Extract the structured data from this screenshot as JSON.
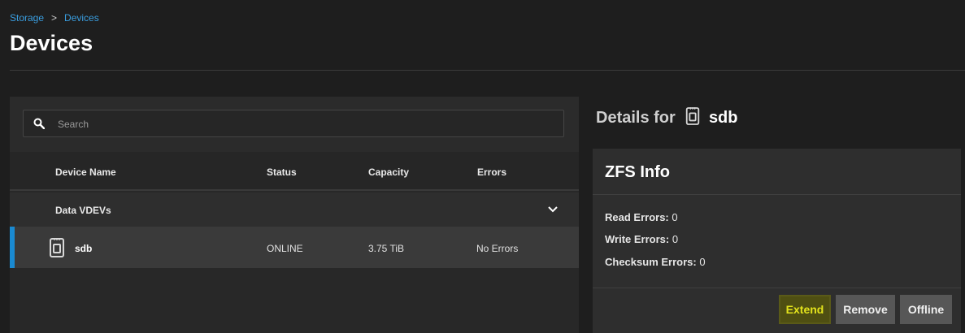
{
  "breadcrumb": {
    "items": [
      "Storage",
      "Devices"
    ],
    "separator": ">"
  },
  "page": {
    "title": "Devices"
  },
  "search": {
    "placeholder": "Search",
    "value": ""
  },
  "table": {
    "columns": [
      "Device Name",
      "Status",
      "Capacity",
      "Errors"
    ],
    "group": {
      "label": "Data VDEVs"
    },
    "rows": [
      {
        "name": "sdb",
        "status": "ONLINE",
        "capacity": "3.75 TiB",
        "errors": "No Errors"
      }
    ]
  },
  "details": {
    "heading_prefix": "Details for",
    "device": "sdb",
    "card_title": "ZFS Info",
    "read_errors_label": "Read Errors:",
    "read_errors_value": "0",
    "write_errors_label": "Write Errors:",
    "write_errors_value": "0",
    "checksum_errors_label": "Checksum Errors:",
    "checksum_errors_value": "0"
  },
  "actions": {
    "extend": "Extend",
    "remove": "Remove",
    "offline": "Offline"
  },
  "colors": {
    "accent": "#1a8ad1",
    "link": "#3a9ee0",
    "extend_highlight": "#e3e31c"
  },
  "icons": {
    "search": "search-icon",
    "chevron": "chevron-down-icon",
    "disk": "disk-icon"
  }
}
